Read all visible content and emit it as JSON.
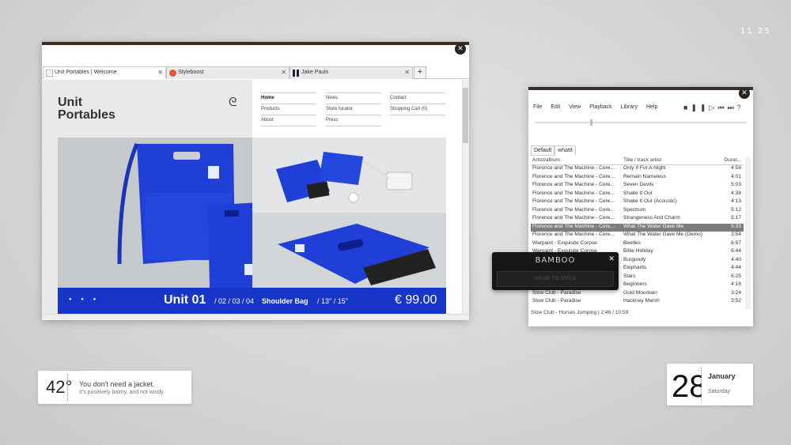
{
  "clock": {
    "time": "11 25"
  },
  "colors": {
    "accent_blue": "#1735c7",
    "wood": "#3b2d24",
    "selection": "#7d7d7d"
  },
  "browser": {
    "tabs": [
      {
        "label": "Unit Portables | Welcome",
        "icon": "dotted-square-icon"
      },
      {
        "label": "Styleboost",
        "icon": "red-circle-icon"
      },
      {
        "label": "Jake Pauls",
        "icon": "bars-icon"
      }
    ],
    "site": {
      "logo_line1": "Unit",
      "logo_line2": "Portables",
      "nav_col1": [
        "Home",
        "Products",
        "About"
      ],
      "nav_col2": [
        "News",
        "Store locator",
        "Press"
      ],
      "nav_col3": [
        "Contact",
        "Shopping Cart (0)"
      ],
      "hero": {
        "title": "Unit 01",
        "variants": "/ 02 / 03 / 04",
        "product": "Shoulder Bag",
        "sizes": "/ 13\" / 15\"",
        "price": "€ 99.00"
      }
    }
  },
  "player": {
    "menu": [
      "File",
      "Edit",
      "View",
      "Playback",
      "Library",
      "Help"
    ],
    "playlist_tabs": [
      "Default",
      "whattt"
    ],
    "columns": [
      "Artist/album",
      "Title / track artist",
      "Durat..."
    ],
    "rows": [
      {
        "artist": "Florence and The Machine - Cere...",
        "title": "Only If For A Night",
        "dur": "4:58"
      },
      {
        "artist": "Florence and The Machine - Cere...",
        "title": "Remain Nameless",
        "dur": "4:01"
      },
      {
        "artist": "Florence and The Machine - Cere...",
        "title": "Seven Devils",
        "dur": "5:03"
      },
      {
        "artist": "Florence and The Machine - Cere...",
        "title": "Shake It Out",
        "dur": "4:38"
      },
      {
        "artist": "Florence and The Machine - Cere...",
        "title": "Shake It Out (Acoustic)",
        "dur": "4:13"
      },
      {
        "artist": "Florence and The Machine - Cere...",
        "title": "Spectrum",
        "dur": "5:12"
      },
      {
        "artist": "Florence and The Machine - Cere...",
        "title": "Strangeness And Charm",
        "dur": "5:17"
      },
      {
        "artist": "Florence and The Machine - Cere...",
        "title": "What The Water Gave Me",
        "dur": "5:33"
      },
      {
        "artist": "Florence and The Machine - Cere...",
        "title": "What The Water Gave Me (Demo)",
        "dur": "3:54"
      },
      {
        "artist": "Warpaint - Exquisite Corpse",
        "title": "Beetles",
        "dur": "6:57"
      },
      {
        "artist": "Warpaint - Exquisite Corpse",
        "title": "Billie Holiday",
        "dur": "6:44"
      },
      {
        "artist": "",
        "title": "Burgundy",
        "dur": "4:40"
      },
      {
        "artist": "",
        "title": "Elephants",
        "dur": "4:44"
      },
      {
        "artist": "",
        "title": "Stars",
        "dur": "6:25"
      },
      {
        "artist": "",
        "title": "Beginners",
        "dur": "4:16"
      },
      {
        "artist": "Slow Club - Paradise",
        "title": "Gold Mountain",
        "dur": "3:24"
      },
      {
        "artist": "Slow Club - Paradise",
        "title": "Hackney Marsh",
        "dur": "3:52"
      }
    ],
    "selected_index": 7,
    "status": "Slow Club - Horses Jumping  |  2:46 / 10:59"
  },
  "bamboo": {
    "brand": "BAMBOO",
    "button": "DRAW TO OPEN"
  },
  "weather": {
    "temp": "42°",
    "line1": "You don't need a jacket.",
    "line2": "It's positively balmy, and not windy."
  },
  "date": {
    "day": "28",
    "month": "January",
    "weekday": "Saturday"
  }
}
